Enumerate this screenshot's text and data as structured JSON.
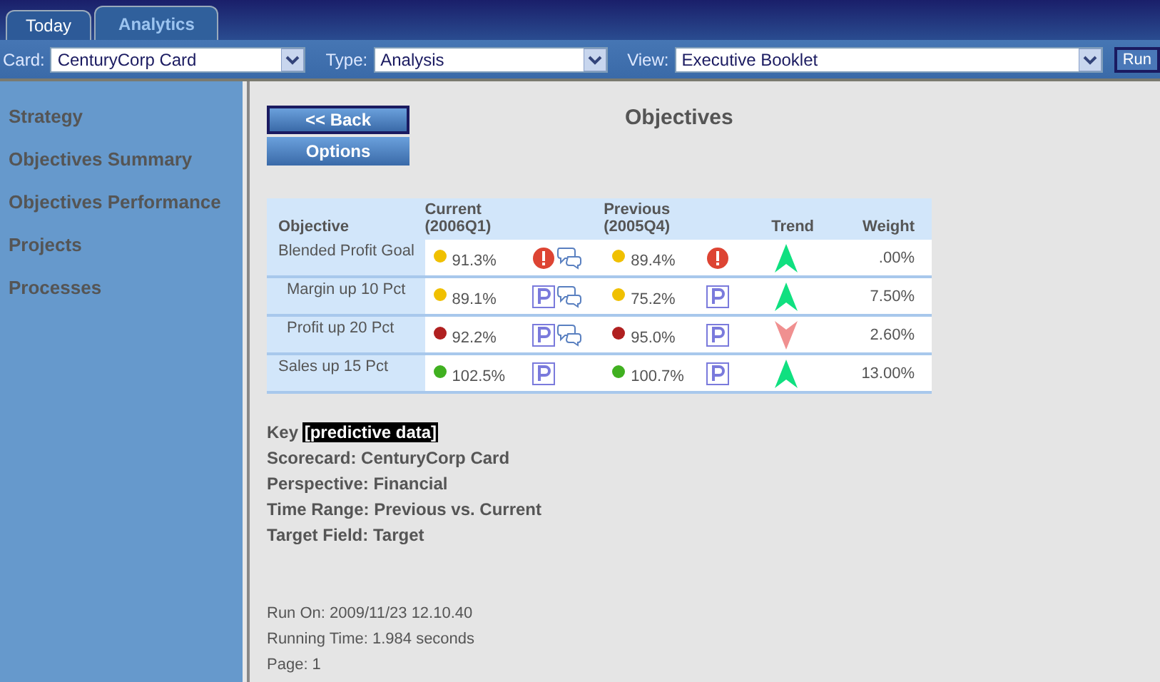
{
  "tabs": [
    {
      "label": "Today",
      "selected": false
    },
    {
      "label": "Analytics",
      "selected": true
    }
  ],
  "toolbar": {
    "card": {
      "label": "Card:",
      "value": "CenturyCorp Card"
    },
    "type": {
      "label": "Type:",
      "value": "Analysis"
    },
    "view": {
      "label": "View:",
      "value": "Executive Booklet"
    },
    "run_button": "Run"
  },
  "sidebar": {
    "items": [
      "Strategy",
      "Objectives Summary",
      "Objectives Performance",
      "Projects",
      "Processes"
    ]
  },
  "buttons": {
    "back": "<< Back",
    "options": "Options"
  },
  "title": "Objectives",
  "table": {
    "columns": [
      "Objective",
      "Current\n(2006Q1)",
      "Previous\n(2005Q4)",
      "Trend",
      "Weight"
    ],
    "rows": [
      {
        "objective": "Blended Profit Goal",
        "current": {
          "color": "#f0c000",
          "value": "91.3%",
          "icons": [
            {
              "kind": "alert"
            },
            {
              "kind": "comment"
            }
          ]
        },
        "previous": {
          "color": "#f0c000",
          "value": "89.4%",
          "icons": [
            {
              "kind": "alert"
            }
          ]
        },
        "trend": {
          "kind": "up"
        },
        "weight": ".00%",
        "children": [
          {
            "objective": "Margin up 10 Pct",
            "current": {
              "color": "#f0c000",
              "value": "89.1%",
              "icons": [
                {
                  "kind": "predictive"
                },
                {
                  "kind": "comment"
                }
              ]
            },
            "previous": {
              "color": "#f0c000",
              "value": "75.2%",
              "icons": [
                {
                  "kind": "predictive"
                }
              ]
            },
            "trend": {
              "kind": "up"
            },
            "weight": "7.50%"
          },
          {
            "objective": "Profit up 20 Pct",
            "current": {
              "color": "#b02020",
              "value": "92.2%",
              "icons": [
                {
                  "kind": "predictive"
                },
                {
                  "kind": "comment"
                }
              ]
            },
            "previous": {
              "color": "#b02020",
              "value": "95.0%",
              "icons": [
                {
                  "kind": "predictive"
                }
              ]
            },
            "trend": {
              "kind": "down"
            },
            "weight": "2.60%"
          }
        ]
      },
      {
        "objective": "Sales up 15 Pct",
        "current": {
          "color": "#40b020",
          "value": "102.5%",
          "icons": [
            {
              "kind": "predictive"
            }
          ]
        },
        "previous": {
          "color": "#40b020",
          "value": "100.7%",
          "icons": [
            {
              "kind": "predictive"
            }
          ]
        },
        "trend": {
          "kind": "up"
        },
        "weight": "13.00%"
      }
    ]
  },
  "key": {
    "label": "Key",
    "tag": "[predictive data]"
  },
  "details": [
    "Scorecard: CenturyCorp Card",
    "Perspective: Financial",
    "Time Range: Previous vs. Current",
    "Target Field: Target"
  ],
  "run_info": [
    "Run On: 2009/11/23 12.10.40",
    "Running Time: 1.984 seconds",
    "Page: 1"
  ]
}
